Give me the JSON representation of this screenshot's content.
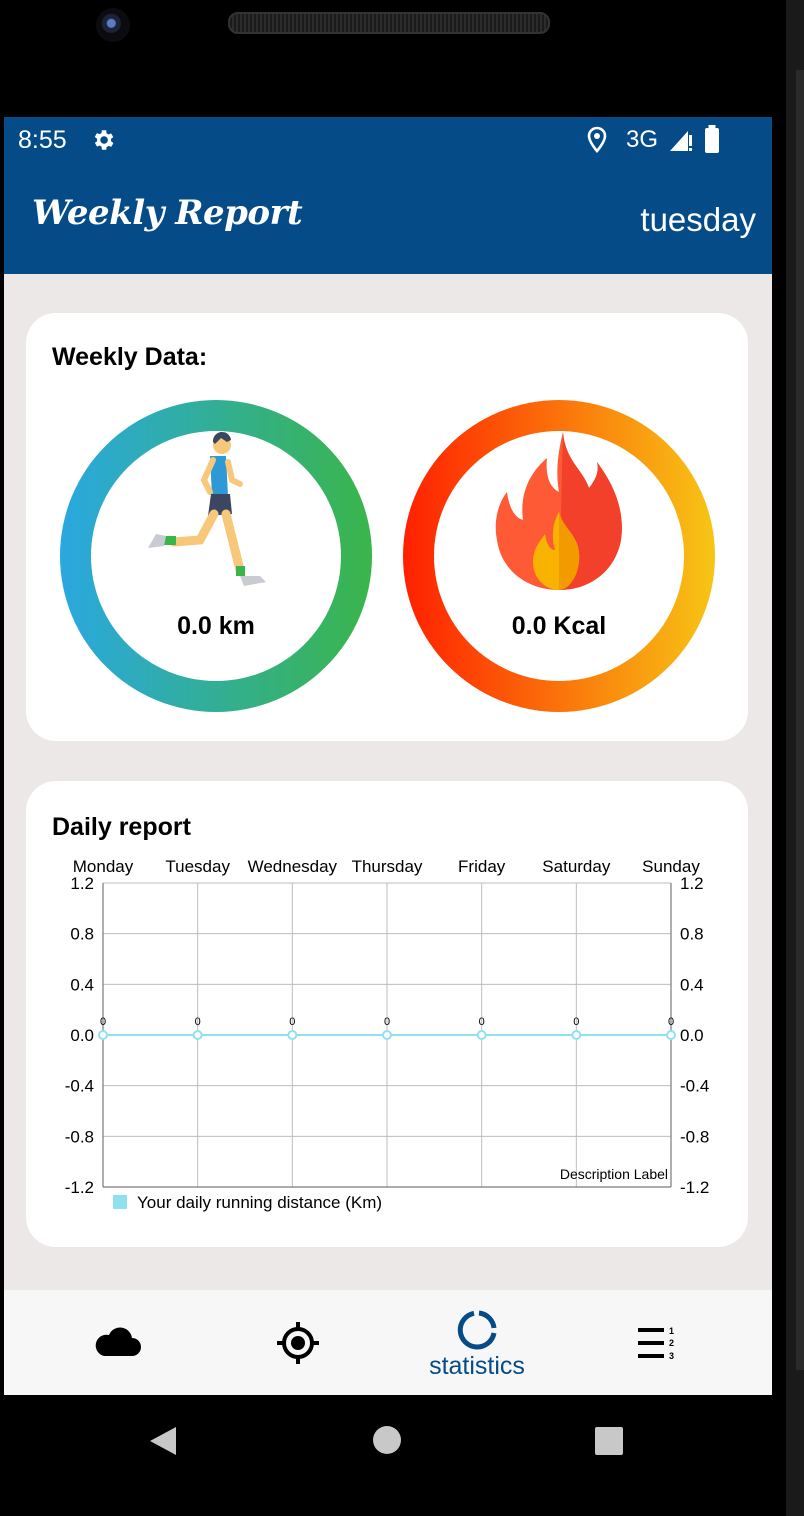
{
  "status_bar": {
    "time": "8:55",
    "network": "3G"
  },
  "app_bar": {
    "title": "Weekly Report",
    "day": "tuesday"
  },
  "weekly_card": {
    "title": "Weekly Data:",
    "distance_value": "0.0 km",
    "calories_value": "0.0 Kcal",
    "distance_ring_colors": [
      "#2aa8e0",
      "#3ab54a"
    ],
    "calories_ring_colors": [
      "#ff2000",
      "#f7c515"
    ]
  },
  "daily_card": {
    "title": "Daily report"
  },
  "chart_data": {
    "type": "line",
    "categories": [
      "Monday",
      "Tuesday",
      "Wednesday",
      "Thursday",
      "Friday",
      "Saturday",
      "Sunday"
    ],
    "series": [
      {
        "name": "Your daily running distance (Km)",
        "values": [
          0,
          0,
          0,
          0,
          0,
          0,
          0
        ],
        "color": "#8fe1f2"
      }
    ],
    "value_labels": [
      "0",
      "0",
      "0",
      "0",
      "0",
      "0",
      "0"
    ],
    "y_ticks": [
      "1.2",
      "0.8",
      "0.4",
      "0.0",
      "-0.4",
      "-0.8",
      "-1.2"
    ],
    "ylim": [
      -1.2,
      1.2
    ],
    "description": "Description Label",
    "grid": true,
    "legend": "bottom-left"
  },
  "bottom_nav": {
    "items": [
      {
        "icon": "cloud-icon"
      },
      {
        "icon": "crosshair-icon"
      },
      {
        "icon": "statistics-icon",
        "label": "statistics",
        "active": true
      },
      {
        "icon": "ranking-list-icon"
      }
    ],
    "active_color": "#044b88"
  }
}
